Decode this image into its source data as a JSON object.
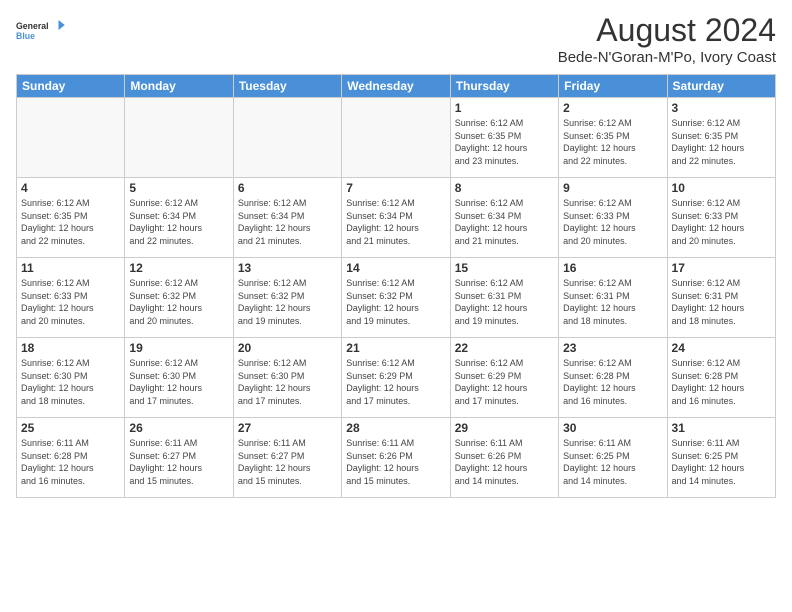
{
  "logo": {
    "line1": "General",
    "line2": "Blue"
  },
  "title": "August 2024",
  "subtitle": "Bede-N'Goran-M'Po, Ivory Coast",
  "days_header": [
    "Sunday",
    "Monday",
    "Tuesday",
    "Wednesday",
    "Thursday",
    "Friday",
    "Saturday"
  ],
  "weeks": [
    [
      {
        "day": "",
        "info": ""
      },
      {
        "day": "",
        "info": ""
      },
      {
        "day": "",
        "info": ""
      },
      {
        "day": "",
        "info": ""
      },
      {
        "day": "1",
        "info": "Sunrise: 6:12 AM\nSunset: 6:35 PM\nDaylight: 12 hours\nand 23 minutes."
      },
      {
        "day": "2",
        "info": "Sunrise: 6:12 AM\nSunset: 6:35 PM\nDaylight: 12 hours\nand 22 minutes."
      },
      {
        "day": "3",
        "info": "Sunrise: 6:12 AM\nSunset: 6:35 PM\nDaylight: 12 hours\nand 22 minutes."
      }
    ],
    [
      {
        "day": "4",
        "info": "Sunrise: 6:12 AM\nSunset: 6:35 PM\nDaylight: 12 hours\nand 22 minutes."
      },
      {
        "day": "5",
        "info": "Sunrise: 6:12 AM\nSunset: 6:34 PM\nDaylight: 12 hours\nand 22 minutes."
      },
      {
        "day": "6",
        "info": "Sunrise: 6:12 AM\nSunset: 6:34 PM\nDaylight: 12 hours\nand 21 minutes."
      },
      {
        "day": "7",
        "info": "Sunrise: 6:12 AM\nSunset: 6:34 PM\nDaylight: 12 hours\nand 21 minutes."
      },
      {
        "day": "8",
        "info": "Sunrise: 6:12 AM\nSunset: 6:34 PM\nDaylight: 12 hours\nand 21 minutes."
      },
      {
        "day": "9",
        "info": "Sunrise: 6:12 AM\nSunset: 6:33 PM\nDaylight: 12 hours\nand 20 minutes."
      },
      {
        "day": "10",
        "info": "Sunrise: 6:12 AM\nSunset: 6:33 PM\nDaylight: 12 hours\nand 20 minutes."
      }
    ],
    [
      {
        "day": "11",
        "info": "Sunrise: 6:12 AM\nSunset: 6:33 PM\nDaylight: 12 hours\nand 20 minutes."
      },
      {
        "day": "12",
        "info": "Sunrise: 6:12 AM\nSunset: 6:32 PM\nDaylight: 12 hours\nand 20 minutes."
      },
      {
        "day": "13",
        "info": "Sunrise: 6:12 AM\nSunset: 6:32 PM\nDaylight: 12 hours\nand 19 minutes."
      },
      {
        "day": "14",
        "info": "Sunrise: 6:12 AM\nSunset: 6:32 PM\nDaylight: 12 hours\nand 19 minutes."
      },
      {
        "day": "15",
        "info": "Sunrise: 6:12 AM\nSunset: 6:31 PM\nDaylight: 12 hours\nand 19 minutes."
      },
      {
        "day": "16",
        "info": "Sunrise: 6:12 AM\nSunset: 6:31 PM\nDaylight: 12 hours\nand 18 minutes."
      },
      {
        "day": "17",
        "info": "Sunrise: 6:12 AM\nSunset: 6:31 PM\nDaylight: 12 hours\nand 18 minutes."
      }
    ],
    [
      {
        "day": "18",
        "info": "Sunrise: 6:12 AM\nSunset: 6:30 PM\nDaylight: 12 hours\nand 18 minutes."
      },
      {
        "day": "19",
        "info": "Sunrise: 6:12 AM\nSunset: 6:30 PM\nDaylight: 12 hours\nand 17 minutes."
      },
      {
        "day": "20",
        "info": "Sunrise: 6:12 AM\nSunset: 6:30 PM\nDaylight: 12 hours\nand 17 minutes."
      },
      {
        "day": "21",
        "info": "Sunrise: 6:12 AM\nSunset: 6:29 PM\nDaylight: 12 hours\nand 17 minutes."
      },
      {
        "day": "22",
        "info": "Sunrise: 6:12 AM\nSunset: 6:29 PM\nDaylight: 12 hours\nand 17 minutes."
      },
      {
        "day": "23",
        "info": "Sunrise: 6:12 AM\nSunset: 6:28 PM\nDaylight: 12 hours\nand 16 minutes."
      },
      {
        "day": "24",
        "info": "Sunrise: 6:12 AM\nSunset: 6:28 PM\nDaylight: 12 hours\nand 16 minutes."
      }
    ],
    [
      {
        "day": "25",
        "info": "Sunrise: 6:11 AM\nSunset: 6:28 PM\nDaylight: 12 hours\nand 16 minutes."
      },
      {
        "day": "26",
        "info": "Sunrise: 6:11 AM\nSunset: 6:27 PM\nDaylight: 12 hours\nand 15 minutes."
      },
      {
        "day": "27",
        "info": "Sunrise: 6:11 AM\nSunset: 6:27 PM\nDaylight: 12 hours\nand 15 minutes."
      },
      {
        "day": "28",
        "info": "Sunrise: 6:11 AM\nSunset: 6:26 PM\nDaylight: 12 hours\nand 15 minutes."
      },
      {
        "day": "29",
        "info": "Sunrise: 6:11 AM\nSunset: 6:26 PM\nDaylight: 12 hours\nand 14 minutes."
      },
      {
        "day": "30",
        "info": "Sunrise: 6:11 AM\nSunset: 6:25 PM\nDaylight: 12 hours\nand 14 minutes."
      },
      {
        "day": "31",
        "info": "Sunrise: 6:11 AM\nSunset: 6:25 PM\nDaylight: 12 hours\nand 14 minutes."
      }
    ]
  ]
}
